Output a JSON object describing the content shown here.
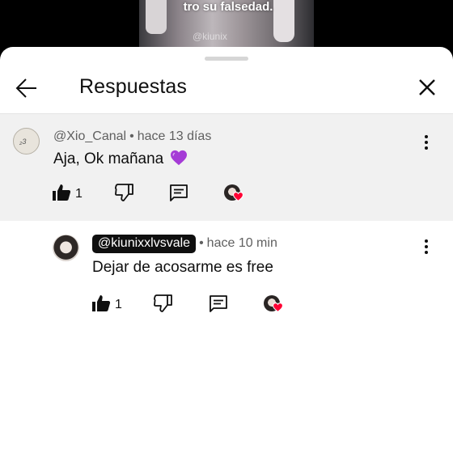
{
  "video": {
    "caption": "tro su falsedad.",
    "watermark": "@kiunix"
  },
  "header": {
    "title": "Respuestas",
    "back_icon": "arrow-left-icon",
    "close_icon": "close-icon"
  },
  "comments": [
    {
      "author": "@Xio_Canal",
      "time": "hace 13 días",
      "text": "Aja, Ok mañana",
      "emoji": "purple-heart",
      "likes": "1",
      "highlighted": true
    },
    {
      "author": "@kiunixxlvsvale",
      "time": "hace 10 min",
      "text": "Dejar de acosarme es free",
      "likes": "1",
      "author_is_creator": true
    }
  ],
  "icons": {
    "like": "thumbs-up-icon",
    "dislike": "thumbs-down-icon",
    "reply": "reply-comment-icon",
    "more": "more-vertical-icon",
    "creator_heart": "creator-heart-icon"
  },
  "colors": {
    "highlight_bg": "#f1f1f1",
    "text_primary": "#0f0f0f",
    "text_secondary": "#606060",
    "heart_red": "#ff0033",
    "emoji_purple": "#a53bd6",
    "chip_bg": "#0f0f0f"
  },
  "separator": "•"
}
